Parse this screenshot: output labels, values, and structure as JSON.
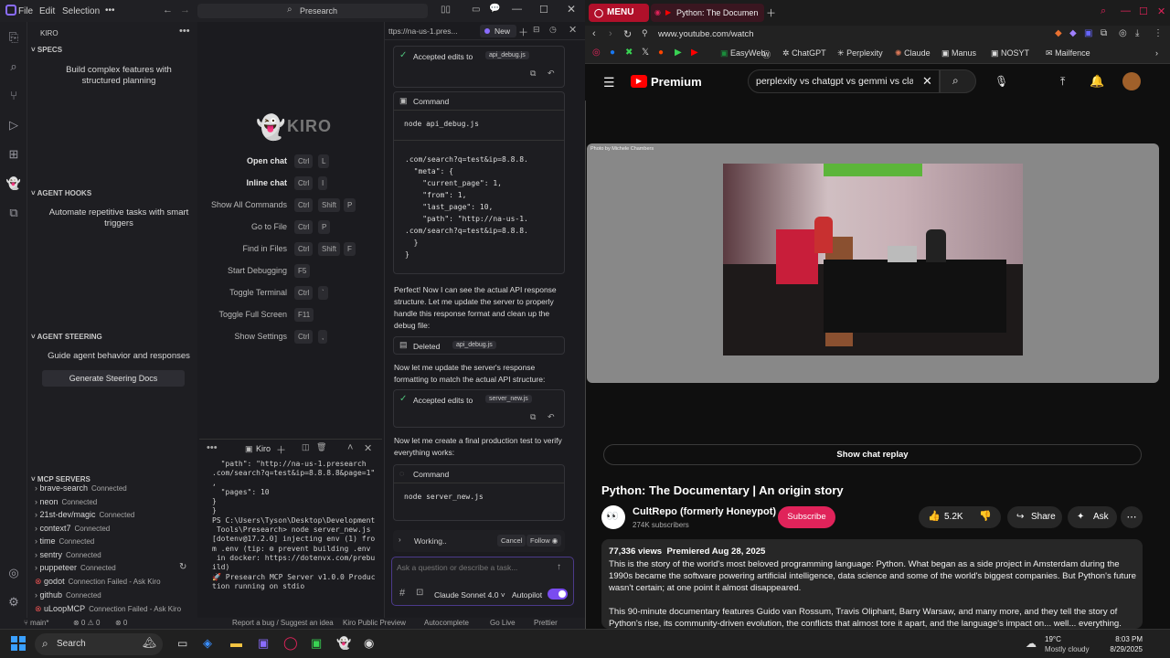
{
  "ide": {
    "menu": [
      "File",
      "Edit",
      "Selection"
    ],
    "menu_more": "•••",
    "search": "Presearch",
    "sidebar_title": "KIRO",
    "specs": {
      "header": "SPECS",
      "text": "Build complex features with structured planning"
    },
    "hooks": {
      "header": "AGENT HOOKS",
      "text": "Automate repetitive tasks with smart triggers"
    },
    "steering": {
      "header": "AGENT STEERING",
      "text": "Guide agent behavior and responses",
      "button": "Generate Steering Docs"
    },
    "mcp": {
      "header": "MCP SERVERS",
      "servers": [
        {
          "name": "brave-search",
          "status": "Connected"
        },
        {
          "name": "neon",
          "status": "Connected"
        },
        {
          "name": "21st-dev/magic",
          "status": "Connected"
        },
        {
          "name": "context7",
          "status": "Connected"
        },
        {
          "name": "time",
          "status": "Connected"
        },
        {
          "name": "sentry",
          "status": "Connected"
        },
        {
          "name": "puppeteer",
          "status": "Connected"
        },
        {
          "name": "godot",
          "status": "Connection Failed - Ask Kiro"
        },
        {
          "name": "github",
          "status": "Connected"
        },
        {
          "name": "uLoopMCP",
          "status": "Connection Failed - Ask Kiro"
        }
      ]
    },
    "welcome": {
      "logo": "KIRO",
      "shortcuts": [
        {
          "label": "Open chat",
          "keys": [
            "Ctrl",
            "L"
          ]
        },
        {
          "label": "Inline chat",
          "keys": [
            "Ctrl",
            "I"
          ]
        },
        {
          "label": "Show All Commands",
          "keys": [
            "Ctrl",
            "Shift",
            "P"
          ]
        },
        {
          "label": "Go to File",
          "keys": [
            "Ctrl",
            "P"
          ]
        },
        {
          "label": "Find in Files",
          "keys": [
            "Ctrl",
            "Shift",
            "F"
          ]
        },
        {
          "label": "Start Debugging",
          "keys": [
            "F5"
          ]
        },
        {
          "label": "Toggle Terminal",
          "keys": [
            "Ctrl",
            "`"
          ]
        },
        {
          "label": "Toggle Full Screen",
          "keys": [
            "F11"
          ]
        },
        {
          "label": "Show Settings",
          "keys": [
            "Ctrl",
            ","
          ]
        }
      ]
    },
    "terminal": {
      "tab": "Kiro",
      "output": "  \"path\": \"http://na-us-1.presearch\n.com/search?q=test&ip=8.8.8.8&page=1\"\n,\n  \"pages\": 10\n}\n}\nPS C:\\Users\\Tyson\\Desktop\\Development\n Tools\\Presearch> node server_new.js\n[dotenv@17.2.0] injecting env (1) fro\nm .env (tip: ⚙ prevent building .env\n in docker: https://dotenvx.com/prebu\nild)\n🚀 Presearch MCP Server v1.0.0 Produc\ntion running on stdio"
    },
    "chat": {
      "tab_url": "ttps://na-us-1.pres...",
      "tab_new": "New",
      "accepted1": "Accepted edits to",
      "file1": "api_debug.js",
      "command_label": "Command",
      "cmd1": "node api_debug.js",
      "code": ".com/search?q=test&ip=8.8.8.\n  \"meta\": {\n    \"current_page\": 1,\n    \"from\": 1,\n    \"last_page\": 10,\n    \"path\": \"http://na-us-1.\n.com/search?q=test&ip=8.8.8.\n  }\n}",
      "msg1": "Perfect! Now I can see the actual API response structure. Let me update the server to properly handle this response format and clean up the debug file:",
      "deleted": "Deleted",
      "file_deleted": "api_debug.js",
      "msg2": "Now let me update the server's response formatting to match the actual API structure:",
      "accepted2": "Accepted edits to",
      "file2": "server_new.js",
      "msg3": "Now let me create a final production test to verify everything works:",
      "command_label2": "Command",
      "cmd2": "node server_new.js",
      "working": "Working..",
      "cancel": "Cancel",
      "follow": "Follow",
      "input_placeholder": "Ask a question or describe a task...",
      "model": "Claude Sonnet 4.0",
      "autopilot": "Autopilot"
    },
    "status": {
      "branch": "main*",
      "errors": "⊗ 0 ⚠ 0",
      "warnings": "⊗ 0",
      "report": "Report a bug / Suggest an idea",
      "preview": "Kiro Public Preview",
      "autocomplete": "Autocomplete",
      "golive": "Go Live",
      "prettier": "Prettier"
    }
  },
  "browser": {
    "menu_tab": "MENU",
    "tab_title": "Python: The Documen",
    "url": "www.youtube.com/watch",
    "bookmarks": [
      "EasyWeb",
      "ChatGPT",
      "Perplexity",
      "Claude",
      "Manus",
      "NOSYT",
      "Mailfence"
    ],
    "yt": {
      "logo": "Premium",
      "search": "perplexity vs chatgpt vs gemmi vs clau",
      "photo_credit": "Photo by Michele Chambers",
      "show_chat": "Show chat replay",
      "title": "Python: The Documentary | An origin story",
      "channel": "CultRepo (formerly Honeypot)",
      "subscribers": "274K subscribers",
      "subscribe": "Subscribe",
      "likes": "5.2K",
      "share": "Share",
      "ask": "Ask",
      "views": "77,336 views",
      "premiered": "Premiered Aug 28, 2025",
      "desc1": "This is the story of the world's most beloved programming language: Python. What began as a side project in Amsterdam during the 1990s became the software powering artificial intelligence, data science and some of the world's biggest companies. But Python's future wasn't certain; at one point it almost disappeared.",
      "desc2": "This 90-minute documentary features Guido van Rossum, Travis Oliphant, Barry Warsaw, and many more, and they tell the story of Python's rise, its community-driven evolution, the conflicts that almost tore it apart, and the language's impact on... well... everything."
    }
  },
  "taskbar": {
    "search": "Search",
    "weather_temp": "19°C",
    "weather_desc": "Mostly cloudy",
    "time": "8:03 PM",
    "date": "8/29/2025"
  }
}
